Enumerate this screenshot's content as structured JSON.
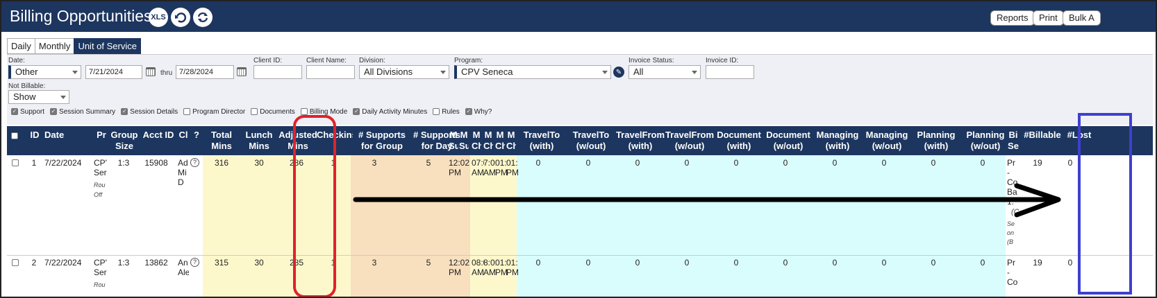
{
  "header": {
    "title": "Billing Opportunities",
    "xls_label": "XLS",
    "buttons": {
      "reports": "Reports",
      "print": "Print",
      "bulk": "Bulk A"
    }
  },
  "tabs": [
    "Daily",
    "Monthly",
    "Unit of Service"
  ],
  "filters": {
    "date": {
      "label": "Date:",
      "value": "Other",
      "from": "7/21/2024",
      "thru": "thru",
      "to": "7/28/2024"
    },
    "client_id": {
      "label": "Client ID:",
      "value": ""
    },
    "client_name": {
      "label": "Client Name:",
      "value": ""
    },
    "division": {
      "label": "Division:",
      "value": "All Divisions"
    },
    "program": {
      "label": "Program:",
      "value": "CPV Seneca"
    },
    "invoice_status": {
      "label": "Invoice Status:",
      "value": "All"
    },
    "invoice_id": {
      "label": "Invoice ID:",
      "value": ""
    },
    "not_billable": {
      "label": "Not Billable:",
      "value": "Show"
    },
    "checkboxes": [
      {
        "label": "Support",
        "checked": true
      },
      {
        "label": "Session Summary",
        "checked": true
      },
      {
        "label": "Session Details",
        "checked": true
      },
      {
        "label": "Program Director",
        "checked": false
      },
      {
        "label": "Documents",
        "checked": false
      },
      {
        "label": "Billing Mode",
        "checked": false
      },
      {
        "label": "Daily Activity Minutes",
        "checked": true
      },
      {
        "label": "Rules",
        "checked": false
      },
      {
        "label": "Why?",
        "checked": true
      }
    ]
  },
  "table": {
    "headers": {
      "id": "ID",
      "date": "Date",
      "pr": "Pr",
      "group_size": "Group Size",
      "acct_id": "Acct ID",
      "cl": "Cl",
      "q": "?",
      "total_mins": "Total Mins",
      "lunch_mins": "Lunch Mins",
      "adjusted_mins": "Adjusted Mins",
      "checkins": "Checkins",
      "supports_group": "# Supports for Group",
      "supports_day": "# Supports for Day",
      "m1": "M Su",
      "m2": "M Su",
      "m3": "M Ch",
      "m4": "M Ch",
      "m5": "M Ch",
      "m6": "M Ch",
      "travelto_with": "TravelTo (with)",
      "travelto_without": "TravelTo (w/out)",
      "travelfrom_with": "TravelFrom (with)",
      "travelfrom_without": "TravelFrom (w/out)",
      "document_with": "Document (with)",
      "document_without": "Document (w/out)",
      "managing_with": "Managing (with)",
      "managing_without": "Managing (w/out)",
      "planning_with": "Planning (with)",
      "planning_without": "Planning (w/out)",
      "bi": "Bi Se",
      "billable": "#Billable",
      "lost": "#Lost"
    },
    "rows": [
      {
        "id": "1",
        "date": "7/22/2024",
        "pr": "CP' Ser",
        "pr_sub1": "Rou",
        "pr_sub2": "Off",
        "group_size": "1:3",
        "acct_id": "15908",
        "cl": "Ad Mi D",
        "total": "316",
        "lunch": "30",
        "adjusted": "286",
        "checkins": "1",
        "sup_group": "3",
        "sup_day": "5",
        "m": [
          "12:02 PM",
          "",
          "07:0 AM",
          "7:01 AM",
          "01: PM",
          "01: PM"
        ],
        "t": [
          "0",
          "0",
          "0",
          "0",
          "0",
          "0",
          "0",
          "0",
          "0",
          "0"
        ],
        "bi": [
          "Pr",
          "-",
          "Co",
          "Ba",
          "1:",
          "(C",
          "Se",
          "on",
          "(B"
        ],
        "billable": "19",
        "lost": "0"
      },
      {
        "id": "2",
        "date": "7/22/2024",
        "pr": "CP' Ser",
        "pr_sub1": "Rou",
        "pr_sub2": "",
        "group_size": "1:3",
        "acct_id": "13862",
        "cl": "An Ale",
        "total": "315",
        "lunch": "30",
        "adjusted": "285",
        "checkins": "1",
        "sup_group": "3",
        "sup_day": "5",
        "m": [
          "12:02 PM",
          "",
          "08:0 AM",
          "8:01 AM",
          "01: PM",
          "01: PM"
        ],
        "t": [
          "0",
          "0",
          "0",
          "0",
          "0",
          "0",
          "0",
          "0",
          "0",
          "0"
        ],
        "bi": [
          "Pr",
          "-",
          "Co"
        ],
        "billable": "19",
        "lost": "0"
      }
    ]
  },
  "colors": {
    "header_bg": "#1d365f",
    "yellow_col": "#fdf8cc",
    "orange_col": "#f8dfbe",
    "cyan_col": "#d9fdfd",
    "annotation_red": "#e0222a",
    "annotation_blue": "#3f3fcf"
  },
  "icons": [
    "xls-icon",
    "undo-icon",
    "refresh-icon",
    "calendar-icon",
    "edit-icon",
    "question-icon"
  ]
}
